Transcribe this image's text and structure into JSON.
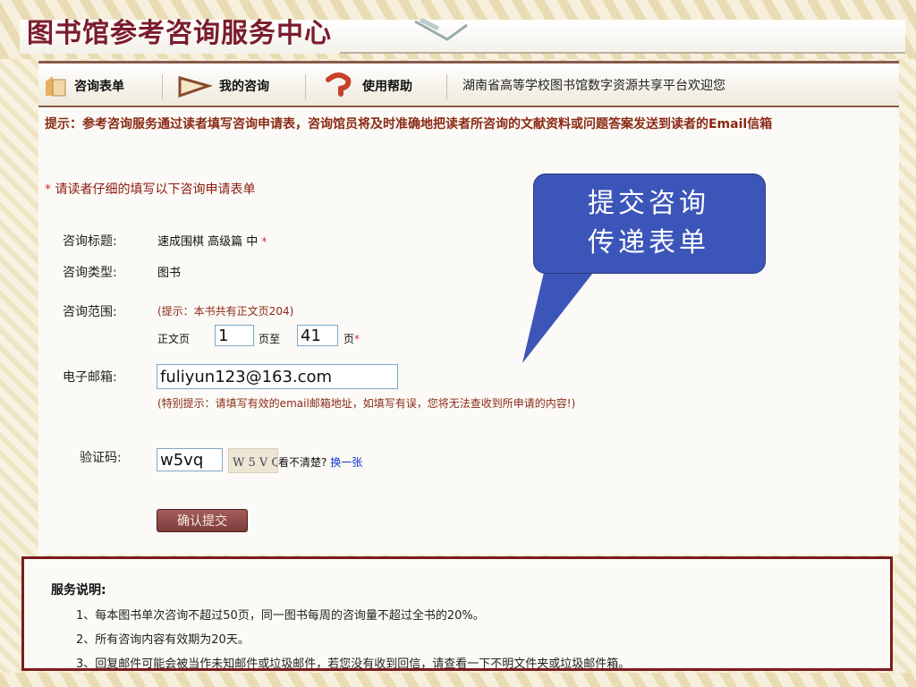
{
  "header": {
    "site_title": "图书馆参考咨询服务中心"
  },
  "nav": {
    "items": [
      {
        "label": "咨询表单",
        "icon": "form-icon"
      },
      {
        "label": "我的咨询",
        "icon": "arrow-play-icon"
      },
      {
        "label": "使用帮助",
        "icon": "help-icon"
      }
    ],
    "welcome": "湖南省高等学校图书馆数字资源共享平台欢迎您"
  },
  "tip": "提示：参考咨询服务通过读者填写咨询申请表，咨询馆员将及时准确地把读者所咨询的文献资料或问题答案发送到读者的Email信箱",
  "form": {
    "note_star": "*",
    "note": "请读者仔细的填写以下咨询申请表单",
    "title_label": "咨询标题:",
    "title_value": "速成围棋 高级篇 中",
    "required_mark": "*",
    "type_label": "咨询类型:",
    "type_value": "图书",
    "range_label": "咨询范围:",
    "range_hint": "(提示：本书共有正文页204)",
    "range_prefix": "正文页",
    "range_from": "1",
    "range_mid": "页至",
    "range_to": "41",
    "range_suffix": "页",
    "email_label": "电子邮箱:",
    "email_value": "fuliyun123@163.com",
    "email_hint": "(特别提示：请填写有效的email邮箱地址，如填写有误，您将无法查收到所申请的内容!)",
    "captcha_label": "验证码:",
    "captcha_value": "w5vq",
    "captcha_image_text": "W 5 V Q",
    "unclear_text": "看不清楚?",
    "change_link": "换一张",
    "submit_label": "确认提交"
  },
  "callout": {
    "line1": "提交咨询",
    "line2": "传递表单",
    "color": "#3c55b8"
  },
  "service": {
    "title": "服务说明:",
    "items": [
      "1、每本图书单次咨询不超过50页，同一图书每周的咨询量不超过全书的20%。",
      "2、所有咨询内容有效期为20天。",
      "3、回复邮件可能会被当作未知邮件或垃圾邮件，若您没有收到回信，请查看一下不明文件夹或垃圾邮件箱。"
    ]
  },
  "colors": {
    "brand": "#7a1c2c",
    "tip_text": "#8b2a16",
    "link": "#1133cc",
    "border": "#7a1c1c"
  }
}
